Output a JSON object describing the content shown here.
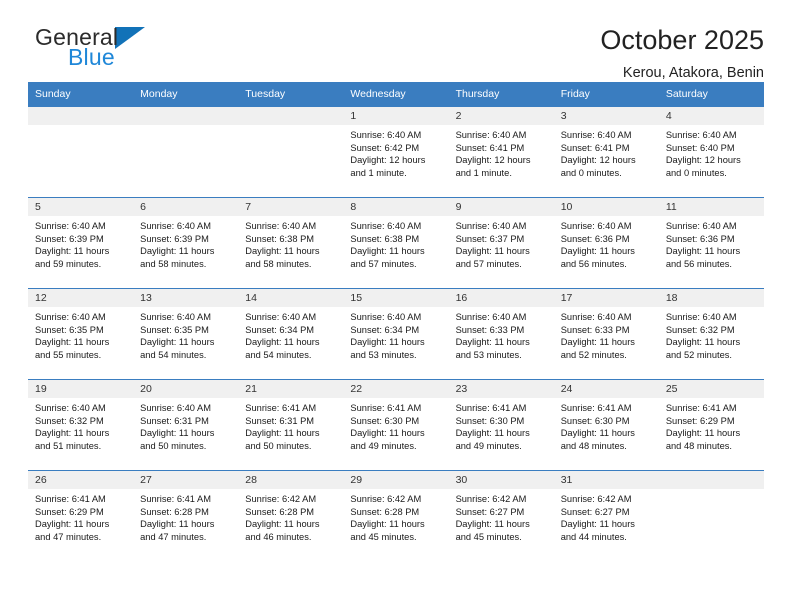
{
  "brand": {
    "line1": "General",
    "line2": "Blue",
    "triangle_icon": "brand-triangle-icon",
    "triangle_color": "#1272b8",
    "line2_color": "#1f87d8"
  },
  "header": {
    "title": "October 2025",
    "subtitle": "Kerou, Atakora, Benin"
  },
  "colors": {
    "header_row_bg": "#3a7dc0",
    "header_row_text": "#ffffff",
    "daynum_bg": "#f0f0f0",
    "grid_line": "#3a7dc0"
  },
  "weekdays": [
    "Sunday",
    "Monday",
    "Tuesday",
    "Wednesday",
    "Thursday",
    "Friday",
    "Saturday"
  ],
  "labels": {
    "sunrise": "Sunrise:",
    "sunset": "Sunset:",
    "daylight": "Daylight:"
  },
  "weeks": [
    [
      {
        "day": "",
        "empty": true
      },
      {
        "day": "",
        "empty": true
      },
      {
        "day": "",
        "empty": true
      },
      {
        "day": "1",
        "sunrise": "Sunrise: 6:40 AM",
        "sunset": "Sunset: 6:42 PM",
        "daylight1": "Daylight: 12 hours",
        "daylight2": "and 1 minute."
      },
      {
        "day": "2",
        "sunrise": "Sunrise: 6:40 AM",
        "sunset": "Sunset: 6:41 PM",
        "daylight1": "Daylight: 12 hours",
        "daylight2": "and 1 minute."
      },
      {
        "day": "3",
        "sunrise": "Sunrise: 6:40 AM",
        "sunset": "Sunset: 6:41 PM",
        "daylight1": "Daylight: 12 hours",
        "daylight2": "and 0 minutes."
      },
      {
        "day": "4",
        "sunrise": "Sunrise: 6:40 AM",
        "sunset": "Sunset: 6:40 PM",
        "daylight1": "Daylight: 12 hours",
        "daylight2": "and 0 minutes."
      }
    ],
    [
      {
        "day": "5",
        "sunrise": "Sunrise: 6:40 AM",
        "sunset": "Sunset: 6:39 PM",
        "daylight1": "Daylight: 11 hours",
        "daylight2": "and 59 minutes."
      },
      {
        "day": "6",
        "sunrise": "Sunrise: 6:40 AM",
        "sunset": "Sunset: 6:39 PM",
        "daylight1": "Daylight: 11 hours",
        "daylight2": "and 58 minutes."
      },
      {
        "day": "7",
        "sunrise": "Sunrise: 6:40 AM",
        "sunset": "Sunset: 6:38 PM",
        "daylight1": "Daylight: 11 hours",
        "daylight2": "and 58 minutes."
      },
      {
        "day": "8",
        "sunrise": "Sunrise: 6:40 AM",
        "sunset": "Sunset: 6:38 PM",
        "daylight1": "Daylight: 11 hours",
        "daylight2": "and 57 minutes."
      },
      {
        "day": "9",
        "sunrise": "Sunrise: 6:40 AM",
        "sunset": "Sunset: 6:37 PM",
        "daylight1": "Daylight: 11 hours",
        "daylight2": "and 57 minutes."
      },
      {
        "day": "10",
        "sunrise": "Sunrise: 6:40 AM",
        "sunset": "Sunset: 6:36 PM",
        "daylight1": "Daylight: 11 hours",
        "daylight2": "and 56 minutes."
      },
      {
        "day": "11",
        "sunrise": "Sunrise: 6:40 AM",
        "sunset": "Sunset: 6:36 PM",
        "daylight1": "Daylight: 11 hours",
        "daylight2": "and 56 minutes."
      }
    ],
    [
      {
        "day": "12",
        "sunrise": "Sunrise: 6:40 AM",
        "sunset": "Sunset: 6:35 PM",
        "daylight1": "Daylight: 11 hours",
        "daylight2": "and 55 minutes."
      },
      {
        "day": "13",
        "sunrise": "Sunrise: 6:40 AM",
        "sunset": "Sunset: 6:35 PM",
        "daylight1": "Daylight: 11 hours",
        "daylight2": "and 54 minutes."
      },
      {
        "day": "14",
        "sunrise": "Sunrise: 6:40 AM",
        "sunset": "Sunset: 6:34 PM",
        "daylight1": "Daylight: 11 hours",
        "daylight2": "and 54 minutes."
      },
      {
        "day": "15",
        "sunrise": "Sunrise: 6:40 AM",
        "sunset": "Sunset: 6:34 PM",
        "daylight1": "Daylight: 11 hours",
        "daylight2": "and 53 minutes."
      },
      {
        "day": "16",
        "sunrise": "Sunrise: 6:40 AM",
        "sunset": "Sunset: 6:33 PM",
        "daylight1": "Daylight: 11 hours",
        "daylight2": "and 53 minutes."
      },
      {
        "day": "17",
        "sunrise": "Sunrise: 6:40 AM",
        "sunset": "Sunset: 6:33 PM",
        "daylight1": "Daylight: 11 hours",
        "daylight2": "and 52 minutes."
      },
      {
        "day": "18",
        "sunrise": "Sunrise: 6:40 AM",
        "sunset": "Sunset: 6:32 PM",
        "daylight1": "Daylight: 11 hours",
        "daylight2": "and 52 minutes."
      }
    ],
    [
      {
        "day": "19",
        "sunrise": "Sunrise: 6:40 AM",
        "sunset": "Sunset: 6:32 PM",
        "daylight1": "Daylight: 11 hours",
        "daylight2": "and 51 minutes."
      },
      {
        "day": "20",
        "sunrise": "Sunrise: 6:40 AM",
        "sunset": "Sunset: 6:31 PM",
        "daylight1": "Daylight: 11 hours",
        "daylight2": "and 50 minutes."
      },
      {
        "day": "21",
        "sunrise": "Sunrise: 6:41 AM",
        "sunset": "Sunset: 6:31 PM",
        "daylight1": "Daylight: 11 hours",
        "daylight2": "and 50 minutes."
      },
      {
        "day": "22",
        "sunrise": "Sunrise: 6:41 AM",
        "sunset": "Sunset: 6:30 PM",
        "daylight1": "Daylight: 11 hours",
        "daylight2": "and 49 minutes."
      },
      {
        "day": "23",
        "sunrise": "Sunrise: 6:41 AM",
        "sunset": "Sunset: 6:30 PM",
        "daylight1": "Daylight: 11 hours",
        "daylight2": "and 49 minutes."
      },
      {
        "day": "24",
        "sunrise": "Sunrise: 6:41 AM",
        "sunset": "Sunset: 6:30 PM",
        "daylight1": "Daylight: 11 hours",
        "daylight2": "and 48 minutes."
      },
      {
        "day": "25",
        "sunrise": "Sunrise: 6:41 AM",
        "sunset": "Sunset: 6:29 PM",
        "daylight1": "Daylight: 11 hours",
        "daylight2": "and 48 minutes."
      }
    ],
    [
      {
        "day": "26",
        "sunrise": "Sunrise: 6:41 AM",
        "sunset": "Sunset: 6:29 PM",
        "daylight1": "Daylight: 11 hours",
        "daylight2": "and 47 minutes."
      },
      {
        "day": "27",
        "sunrise": "Sunrise: 6:41 AM",
        "sunset": "Sunset: 6:28 PM",
        "daylight1": "Daylight: 11 hours",
        "daylight2": "and 47 minutes."
      },
      {
        "day": "28",
        "sunrise": "Sunrise: 6:42 AM",
        "sunset": "Sunset: 6:28 PM",
        "daylight1": "Daylight: 11 hours",
        "daylight2": "and 46 minutes."
      },
      {
        "day": "29",
        "sunrise": "Sunrise: 6:42 AM",
        "sunset": "Sunset: 6:28 PM",
        "daylight1": "Daylight: 11 hours",
        "daylight2": "and 45 minutes."
      },
      {
        "day": "30",
        "sunrise": "Sunrise: 6:42 AM",
        "sunset": "Sunset: 6:27 PM",
        "daylight1": "Daylight: 11 hours",
        "daylight2": "and 45 minutes."
      },
      {
        "day": "31",
        "sunrise": "Sunrise: 6:42 AM",
        "sunset": "Sunset: 6:27 PM",
        "daylight1": "Daylight: 11 hours",
        "daylight2": "and 44 minutes."
      },
      {
        "day": "",
        "empty": true
      }
    ]
  ]
}
